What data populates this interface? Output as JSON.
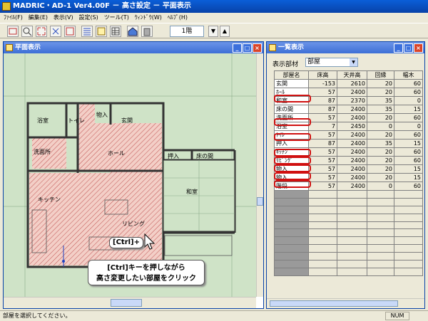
{
  "app": {
    "title": "MADRIC・AD-1 Ver4.00F － 高さ設定 － 平面表示"
  },
  "menu": [
    "ﾌｧｲﾙ(F)",
    "編集(E)",
    "表示(V)",
    "設定(S)",
    "ツール(T)",
    "ｳｨﾝﾄﾞｳ(W)",
    "ﾍﾙﾌﾟ(H)"
  ],
  "toolbar": {
    "floor": "1階",
    "down_arrow": "▼",
    "up_arrow": "▲"
  },
  "plan_window": {
    "title": "平面表示",
    "rooms": {
      "bath": "浴室",
      "toilet": "トイレ",
      "storage1": "物入",
      "entrance": "玄関",
      "washroom": "洗面所",
      "hall": "ホール",
      "oshiire": "押入",
      "tokonoma": "床の間",
      "washitsu": "和室",
      "kitchen": "キッチン",
      "living": "リビング"
    },
    "callout_small": "[Ctrl]+",
    "callout_line1": "[Ctrl]キーを押しながら",
    "callout_line2": "高さ変更したい部屋をクリック"
  },
  "list_window": {
    "title": "一覧表示",
    "filter_label": "表示部材",
    "filter_value": "部屋",
    "columns": [
      "部屋名",
      "床高",
      "天井高",
      "回縁",
      "幅木"
    ],
    "rows": [
      [
        "玄関",
        "-153",
        "2610",
        "20",
        "60"
      ],
      [
        "ﾎｰﾙ",
        "57",
        "2400",
        "20",
        "60"
      ],
      [
        "和室",
        "87",
        "2370",
        "35",
        "0"
      ],
      [
        "床の間",
        "87",
        "2400",
        "35",
        "15"
      ],
      [
        "洗面所",
        "57",
        "2400",
        "20",
        "60"
      ],
      [
        "浴室",
        "7",
        "2450",
        "0",
        "0"
      ],
      [
        "ﾄｲﾚ",
        "57",
        "2400",
        "20",
        "60"
      ],
      [
        "押入",
        "87",
        "2400",
        "35",
        "15"
      ],
      [
        "ｷｯﾁﾝ",
        "57",
        "2400",
        "20",
        "60"
      ],
      [
        "ﾘﾋﾞﾝｸﾞ",
        "57",
        "2400",
        "20",
        "60"
      ],
      [
        "物入",
        "57",
        "2400",
        "20",
        "15"
      ],
      [
        "物入",
        "57",
        "2400",
        "20",
        "15"
      ],
      [
        "階段",
        "57",
        "2400",
        "0",
        "60"
      ]
    ]
  },
  "status": {
    "text": "部屋を選択してください。",
    "num": "NUM"
  },
  "colors": {
    "highlight": "#d01010",
    "plan_bg": "#cfe3c7",
    "hatch": "#c05050"
  }
}
